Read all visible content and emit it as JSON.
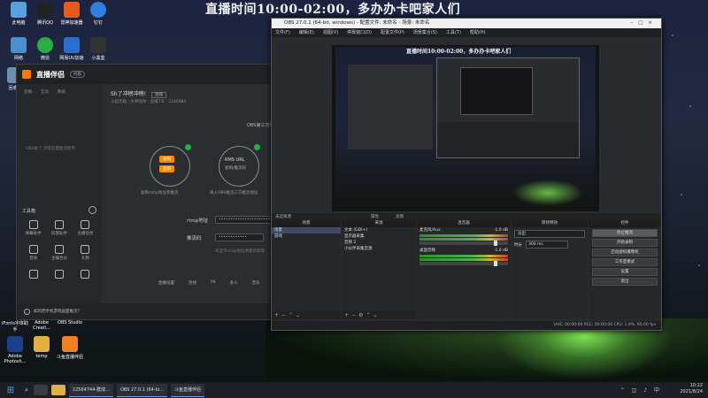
{
  "banner": "直播时间10:00-02:00，多办办卡吧家人们",
  "desktop_icons": [
    {
      "label": "此电脑",
      "color": "#5aa0e0"
    },
    {
      "label": "腾讯QQ",
      "color": "#222"
    },
    {
      "label": "雷神加速器",
      "color": "#e45a1a"
    },
    {
      "label": "钉钉",
      "color": "#2f7fe0"
    },
    {
      "label": "网络",
      "color": "#4a90d0"
    },
    {
      "label": "微信",
      "color": "#2aae43"
    },
    {
      "label": "网易UU加速",
      "color": "#2a6fd0"
    },
    {
      "label": "小黑盒",
      "color": "#333"
    },
    {
      "label": "回收站",
      "color": "#6c8fb0"
    },
    {
      "label": "Adobe Photosh...",
      "color": "#1b3f8a"
    },
    {
      "label": "temp",
      "color": "#e0b040"
    },
    {
      "label": "斗鱼直播伴侣",
      "color": "#f08020"
    },
    {
      "label": "iFonts字体助手",
      "color": "#3060c0"
    },
    {
      "label": "Adobe Creati...",
      "color": "#c02020"
    },
    {
      "label": "OBS Studio",
      "color": "#333"
    }
  ],
  "zhibo": {
    "logo": "直播伴侣",
    "badge": "抖版",
    "tabs": [
      "直播",
      "互动",
      "数据"
    ],
    "title": "Sh了冲榜冲榜!",
    "title_badge": "直播",
    "sub_info": "小超无敌 · 大神陪你 · 直播7天 · 2246884",
    "center_title": "OBS第三方推流",
    "left_hint": "OBS推了 步骤设置推流使用",
    "circle_left_btn1": "复制",
    "circle_left_btn2": "复制",
    "circle_left_caption": "复制rtmp地址到推流",
    "circle_right_label": "RMS URL",
    "circle_right_sub": "复制/推流码",
    "circle_right_caption": "填入OBS推流三方推流地址",
    "rtmp_label": "rtmp地址",
    "rtmp_value": "••••••••••••••••••••••••••••••",
    "key_label": "推流码",
    "key_value": "••••••••••••",
    "hint_text": "未显示rtmp地址请重新获取",
    "tools_title": "工具箱",
    "tools": [
      "弹幕助手",
      "房管助手",
      "主播任务",
      "音效",
      "主播合伙",
      "礼物",
      "...",
      "...",
      "...",
      "...",
      "...",
      "..."
    ],
    "bottom_actions": [
      "直播设置",
      "连线",
      "PK",
      "多人",
      "音乐",
      "更多"
    ],
    "bottom_notice": "如何把手机游戏画面推流？"
  },
  "obs": {
    "title": "OBS 27.0.1 (64-bit, windows) - 配置文件: 未命名 - 场景: 未命名",
    "menu": [
      "文件(F)",
      "编辑(E)",
      "视图(V)",
      "停靠窗口(D)",
      "配置文件(P)",
      "场景集合(S)",
      "工具(T)",
      "帮助(H)"
    ],
    "preview_banner": "直播时间10:00-02:00，多办办卡吧家人们",
    "dock_left": "未选择源",
    "dock_props": "属性",
    "dock_filters": "滤镜",
    "panels": {
      "scenes": {
        "head": "场景",
        "items": [
          "场景",
          "游戏"
        ]
      },
      "sources": {
        "head": "来源",
        "items": [
          "文本 (GDI+)",
          "显示器采集",
          "音频 2",
          "小伙伴采集音源"
        ]
      },
      "mixer": {
        "head": "混音器",
        "tracks": [
          {
            "name": "麦克风/Aux",
            "db": "-1.0 dB"
          },
          {
            "name": "桌面音频",
            "db": "-1.0 dB"
          }
        ]
      },
      "transitions": {
        "head": "转场特效",
        "type": "淡出",
        "duration_label": "时长",
        "duration": "300 ms"
      },
      "controls": {
        "head": "控件",
        "buttons": [
          "停止推流",
          "开始录制",
          "启动虚拟摄像机",
          "工作室模式",
          "设置",
          "退出"
        ]
      }
    },
    "status": "LIVE: 00:00:00   REC: 00:00:00   CPU: 1.9%, 60.00 fps"
  },
  "taskbar": {
    "apps": [
      "22564744-群成...",
      "OBS 27.0.1 (64-bi...",
      "斗鱼直播伴侣"
    ],
    "time": "10:22",
    "date": "2021/8/24"
  }
}
